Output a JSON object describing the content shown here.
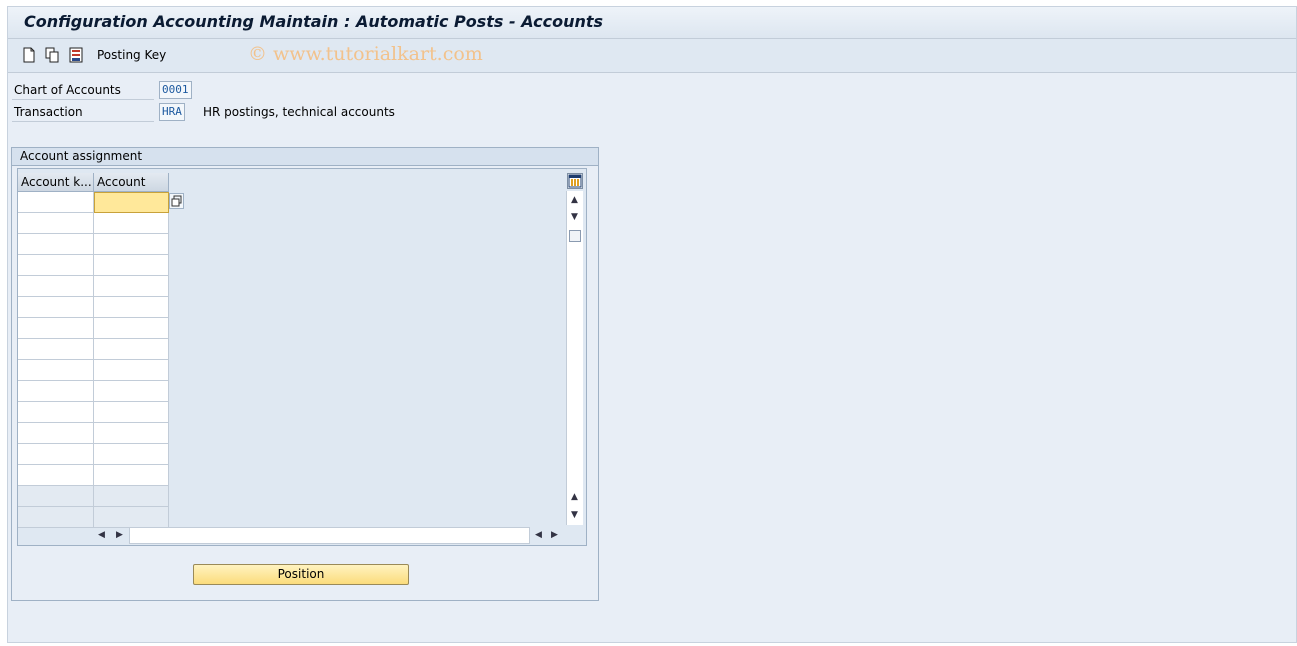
{
  "window": {
    "title": "Configuration Accounting Maintain : Automatic Posts - Accounts"
  },
  "toolbar": {
    "icons": [
      "new-entry-icon",
      "copy-icon",
      "save-icon"
    ],
    "posting_key_label": "Posting Key",
    "watermark": "© www.tutorialkart.com"
  },
  "fields": {
    "chart_of_accounts": {
      "label": "Chart of Accounts",
      "value": "0001"
    },
    "transaction": {
      "label": "Transaction",
      "value": "HRA",
      "description": "HR postings, technical accounts"
    }
  },
  "account_assignment": {
    "title": "Account assignment",
    "columns": [
      "Account k...",
      "Account"
    ],
    "rows": [
      [
        "",
        ""
      ],
      [
        "",
        ""
      ],
      [
        "",
        ""
      ],
      [
        "",
        ""
      ],
      [
        "",
        ""
      ],
      [
        "",
        ""
      ],
      [
        "",
        ""
      ],
      [
        "",
        ""
      ],
      [
        "",
        ""
      ],
      [
        "",
        ""
      ],
      [
        "",
        ""
      ],
      [
        "",
        ""
      ],
      [
        "",
        ""
      ],
      [
        "",
        ""
      ]
    ]
  },
  "buttons": {
    "position": "Position"
  }
}
